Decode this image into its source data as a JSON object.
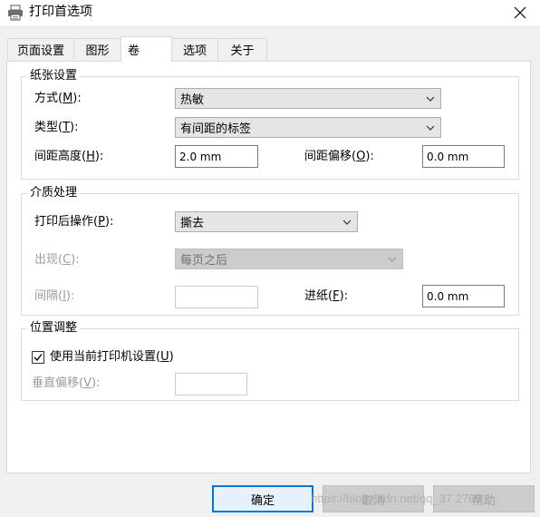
{
  "window": {
    "title": "打印首选项",
    "icon": "printer-icon",
    "close_icon": "close-icon"
  },
  "tabs": [
    {
      "label": "页面设置",
      "active": false
    },
    {
      "label": "图形",
      "active": false
    },
    {
      "label": "卷",
      "active": true
    },
    {
      "label": "选项",
      "active": false
    },
    {
      "label": "关于",
      "active": false
    }
  ],
  "paper": {
    "title": "纸张设置",
    "method": {
      "label": "方式(",
      "key": "M",
      "tail": "):",
      "value": "热敏"
    },
    "type": {
      "label": "类型(",
      "key": "T",
      "tail": "):",
      "value": "有间距的标签"
    },
    "gap_height": {
      "label": "间距高度(",
      "key": "H",
      "tail": "):",
      "value": "2.0 mm"
    },
    "gap_offset": {
      "label": "间距偏移(",
      "key": "O",
      "tail": "):",
      "value": "0.0 mm"
    }
  },
  "media": {
    "title": "介质处理",
    "post_action": {
      "label": "打印后操作(",
      "key": "P",
      "tail": "):",
      "value": "撕去"
    },
    "occurrence": {
      "label": "出现(",
      "key": "C",
      "tail": "):",
      "value": "每页之后"
    },
    "interval": {
      "label": "间隔(",
      "key": "I",
      "tail": "):",
      "value": ""
    },
    "feed": {
      "label": "进纸(",
      "key": "F",
      "tail": "):",
      "value": "0.0 mm"
    }
  },
  "position": {
    "title": "位置调整",
    "use_printer_settings": {
      "label": "使用当前打印机设置(",
      "key": "U",
      "tail": ")",
      "checked": true
    },
    "vertical_offset": {
      "label": "垂直偏移(",
      "key": "V",
      "tail": "):",
      "value": ""
    }
  },
  "buttons": {
    "ok": "确定",
    "cancel": "取消",
    "help": "帮助"
  },
  "watermark": "https://blog.csdn.net/qq_37 2769"
}
